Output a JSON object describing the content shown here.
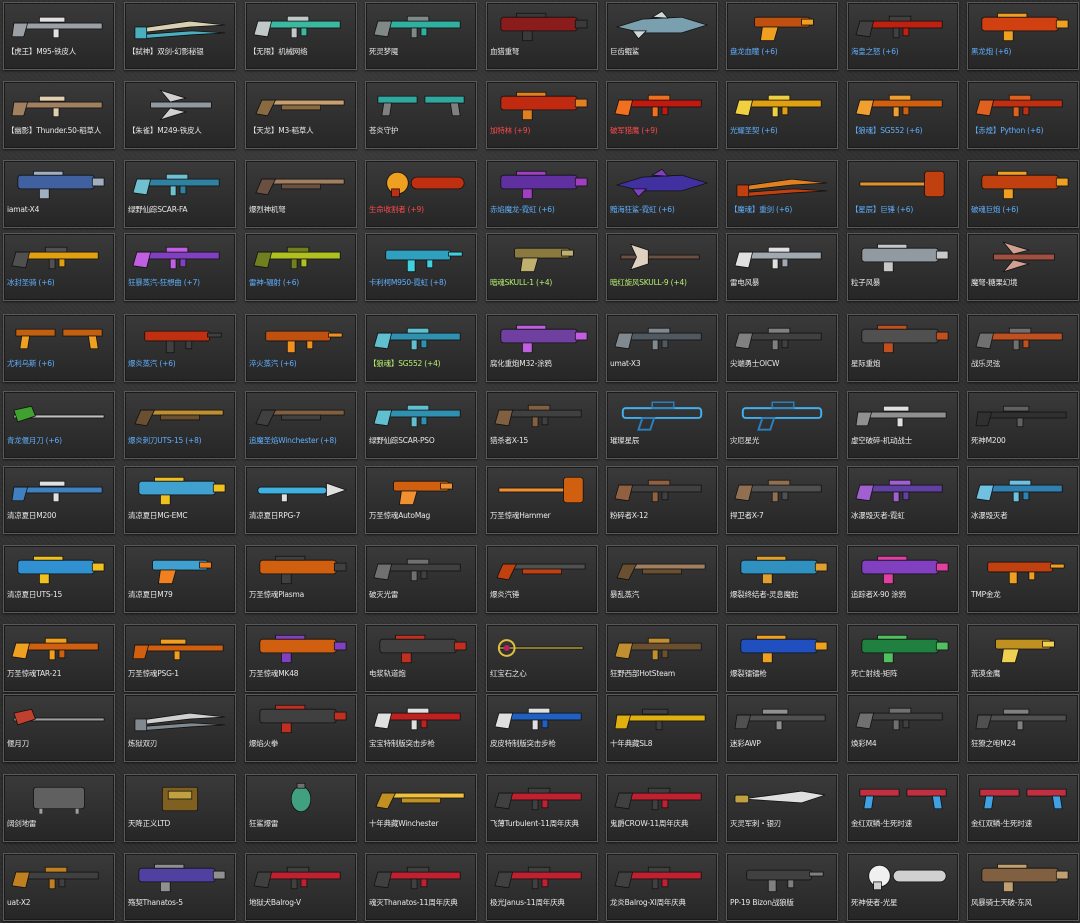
{
  "rows": [
    [
      {
        "name": "【虎王】M95-铁皮人",
        "color": "#e8e8e8",
        "weapon": "sniper",
        "palette": [
          "#9aa0a6",
          "#e0e0e0"
        ]
      },
      {
        "name": "【弑神】双剑-幻影秘银",
        "color": "#e8e8e8",
        "weapon": "blade",
        "palette": [
          "#4ab0c0",
          "#d8d0b0"
        ]
      },
      {
        "name": "【无限】机械网络",
        "color": "#e8e8e8",
        "weapon": "rifle",
        "palette": [
          "#3bb8a0",
          "#c0c8c8"
        ]
      },
      {
        "name": "死灵梦魇",
        "color": "#e8e8e8",
        "weapon": "rifle",
        "palette": [
          "#30b0a0",
          "#808888"
        ]
      },
      {
        "name": "血猎重弩",
        "color": "#e8e8e8",
        "weapon": "heavy",
        "palette": [
          "#8a1c1c",
          "#3a3a3a"
        ]
      },
      {
        "name": "巨齿鲲鲨",
        "color": "#e8e8e8",
        "weapon": "shark",
        "palette": [
          "#7aa0b0",
          "#d0d8dc"
        ]
      },
      {
        "name": "盘龙血瞳 (+6)",
        "color": "#5fb0ff",
        "weapon": "pistol",
        "palette": [
          "#c05010",
          "#f0a020"
        ]
      },
      {
        "name": "海皇之怒 (+6)",
        "color": "#5fb0ff",
        "weapon": "rifle",
        "palette": [
          "#c02010",
          "#404040"
        ]
      },
      {
        "name": "黑龙炮 (+6)",
        "color": "#5fb0ff",
        "weapon": "heavy",
        "palette": [
          "#d04010",
          "#f0a020"
        ]
      }
    ],
    [
      {
        "name": "【幽影】Thunder.50-稻草人",
        "color": "#e8e8e8",
        "weapon": "sniper",
        "palette": [
          "#a08060",
          "#e0d0b0"
        ]
      },
      {
        "name": "【朱雀】M249-铁皮人",
        "color": "#e8e8e8",
        "weapon": "wing",
        "palette": [
          "#9098a0",
          "#d0d0d0"
        ]
      },
      {
        "name": "【天龙】M3-稻草人",
        "color": "#e8e8e8",
        "weapon": "shotgun",
        "palette": [
          "#8a6a40",
          "#c8a070"
        ]
      },
      {
        "name": "苍炎守护",
        "color": "#e8e8e8",
        "weapon": "dual",
        "palette": [
          "#30a8a0",
          "#808080"
        ]
      },
      {
        "name": "加特林 (+9)",
        "color": "#ff4a4a",
        "weapon": "heavy",
        "palette": [
          "#c02a10",
          "#e08020"
        ]
      },
      {
        "name": "破军猎鹰 (+9)",
        "color": "#ff4a4a",
        "weapon": "rifle",
        "palette": [
          "#c01a10",
          "#f07020"
        ]
      },
      {
        "name": "光耀圣契 (+6)",
        "color": "#5fb0ff",
        "weapon": "rifle",
        "palette": [
          "#e0a010",
          "#f0d040"
        ]
      },
      {
        "name": "【狼魂】SG552 (+6)",
        "color": "#5fb0ff",
        "weapon": "rifle",
        "palette": [
          "#d06010",
          "#f0a030"
        ]
      },
      {
        "name": "【赤煌】Python (+6)",
        "color": "#5fb0ff",
        "weapon": "rifle",
        "palette": [
          "#c03010",
          "#e06020"
        ]
      }
    ],
    [
      {
        "name": "iamat-X4",
        "color": "#e8e8e8",
        "weapon": "heavy",
        "palette": [
          "#4060a0",
          "#a0b0c0"
        ]
      },
      {
        "name": "绿野仙踪SCAR-FA",
        "color": "#e8e8e8",
        "weapon": "rifle",
        "palette": [
          "#3080a0",
          "#70c0d0"
        ]
      },
      {
        "name": "爆烈神机弩",
        "color": "#e8e8e8",
        "weapon": "shotgun",
        "palette": [
          "#6a5040",
          "#a08060"
        ]
      },
      {
        "name": "生命收割者 (+9)",
        "color": "#ff4a4a",
        "weapon": "saw",
        "palette": [
          "#c03010",
          "#f0a020"
        ]
      },
      {
        "name": "赤焰魔龙-霓虹 (+6)",
        "color": "#5fb0ff",
        "weapon": "heavy",
        "palette": [
          "#6030a0",
          "#a040c0"
        ]
      },
      {
        "name": "黯海狂鲨-霓虹 (+6)",
        "color": "#5fb0ff",
        "weapon": "shark",
        "palette": [
          "#4030a0",
          "#8040c0"
        ]
      },
      {
        "name": "【魔魂】重剑 (+6)",
        "color": "#5fb0ff",
        "weapon": "blade",
        "palette": [
          "#c04010",
          "#e08020"
        ]
      },
      {
        "name": "【星辰】巨锤 (+6)",
        "color": "#5fb0ff",
        "weapon": "hammer",
        "palette": [
          "#c04010",
          "#e09030"
        ]
      },
      {
        "name": "破魂巨炮 (+6)",
        "color": "#5fb0ff",
        "weapon": "heavy",
        "palette": [
          "#c04010",
          "#f0a020"
        ]
      }
    ],
    [
      {
        "name": "冰封圣骑 (+6)",
        "color": "#5fb0ff",
        "weapon": "rifle",
        "palette": [
          "#e0a010",
          "#505050"
        ]
      },
      {
        "name": "狂暴蒸汽-狂想曲 (+7)",
        "color": "#5fb0ff",
        "weapon": "rifle",
        "palette": [
          "#8040c0",
          "#c060e0"
        ]
      },
      {
        "name": "雷神-辐射 (+6)",
        "color": "#5fb0ff",
        "weapon": "rifle",
        "palette": [
          "#b0c020",
          "#708020"
        ]
      },
      {
        "name": "卡利柯M950-霓虹 (+8)",
        "color": "#5fb0ff",
        "weapon": "smg",
        "palette": [
          "#30a0c0",
          "#40d0e0"
        ]
      },
      {
        "name": "暗魂SKULL-1 (+4)",
        "color": "#b8f070",
        "weapon": "pistol",
        "palette": [
          "#8a7a40",
          "#c0b070"
        ]
      },
      {
        "name": "暗红旋风SKULL-9 (+4)",
        "color": "#b8f070",
        "weapon": "axe",
        "palette": [
          "#6a5040",
          "#e0d0c0"
        ]
      },
      {
        "name": "雷电风暴",
        "color": "#e8e8e8",
        "weapon": "rifle",
        "palette": [
          "#a0a8b0",
          "#e0e0e0"
        ]
      },
      {
        "name": "粒子风暴",
        "color": "#e8e8e8",
        "weapon": "heavy",
        "palette": [
          "#909aa0",
          "#c8c8c8"
        ]
      },
      {
        "name": "魔弩-糖果幻境",
        "color": "#e8e8e8",
        "weapon": "wing",
        "palette": [
          "#a05040",
          "#d0a090"
        ]
      }
    ],
    [
      {
        "name": "尤利乌斯 (+6)",
        "color": "#5fb0ff",
        "weapon": "dual",
        "palette": [
          "#c06010",
          "#f0a020"
        ]
      },
      {
        "name": "爆炎蒸汽 (+6)",
        "color": "#5fb0ff",
        "weapon": "smg",
        "palette": [
          "#c03010",
          "#404040"
        ]
      },
      {
        "name": "淬火蒸汽 (+6)",
        "color": "#5fb0ff",
        "weapon": "smg",
        "palette": [
          "#c05010",
          "#f09020"
        ]
      },
      {
        "name": "【狼魂】SG552 (+4)",
        "color": "#b8f070",
        "weapon": "rifle",
        "palette": [
          "#3090b0",
          "#60c0d0"
        ]
      },
      {
        "name": "腐化重炮M32-涂鸦",
        "color": "#e8e8e8",
        "weapon": "heavy",
        "palette": [
          "#7040a0",
          "#c060e0"
        ]
      },
      {
        "name": "umat-X3",
        "color": "#e8e8e8",
        "weapon": "rifle",
        "palette": [
          "#505860",
          "#808890"
        ]
      },
      {
        "name": "尖端勇士OICW",
        "color": "#e8e8e8",
        "weapon": "rifle",
        "palette": [
          "#404040",
          "#808080"
        ]
      },
      {
        "name": "星际重炮",
        "color": "#e8e8e8",
        "weapon": "heavy",
        "palette": [
          "#505050",
          "#c05020"
        ]
      },
      {
        "name": "战乐灵弦",
        "color": "#e8e8e8",
        "weapon": "rifle",
        "palette": [
          "#c05020",
          "#707070"
        ]
      }
    ],
    [
      {
        "name": "青龙偃月刀 (+6)",
        "color": "#5fb0ff",
        "weapon": "spear",
        "palette": [
          "#40a030",
          "#c0c0c0"
        ]
      },
      {
        "name": "爆炎刺刀UTS-15 (+8)",
        "color": "#5fb0ff",
        "weapon": "shotgun",
        "palette": [
          "#6a5030",
          "#c09030"
        ]
      },
      {
        "name": "追魔圣焰Winchester (+8)",
        "color": "#5fb0ff",
        "weapon": "shotgun",
        "palette": [
          "#404040",
          "#806040"
        ]
      },
      {
        "name": "绿野仙踪SCAR-PSO",
        "color": "#e8e8e8",
        "weapon": "rifle",
        "palette": [
          "#3090b0",
          "#60c0d0"
        ]
      },
      {
        "name": "猎杀者X-15",
        "color": "#e8e8e8",
        "weapon": "rifle",
        "palette": [
          "#404040",
          "#806040"
        ]
      },
      {
        "name": "璀璨星辰",
        "color": "#e8e8e8",
        "weapon": "outline",
        "palette": [
          "#2a80c0",
          "#40b0f0"
        ]
      },
      {
        "name": "灾厄星光",
        "color": "#e8e8e8",
        "weapon": "outline",
        "palette": [
          "#2a80c0",
          "#40b0f0"
        ]
      },
      {
        "name": "虚空破碎-机动战士",
        "color": "#e8e8e8",
        "weapon": "sniper",
        "palette": [
          "#909090",
          "#e0e0e0"
        ]
      },
      {
        "name": "死神M200",
        "color": "#e8e8e8",
        "weapon": "sniper",
        "palette": [
          "#303030",
          "#606060"
        ]
      }
    ],
    [
      {
        "name": "清凉夏日M200",
        "color": "#e8e8e8",
        "weapon": "sniper",
        "palette": [
          "#4080c0",
          "#e0e0e0"
        ]
      },
      {
        "name": "清凉夏日MG-EMC",
        "color": "#e8e8e8",
        "weapon": "heavy",
        "palette": [
          "#40a0d0",
          "#f0c020"
        ]
      },
      {
        "name": "清凉夏日RPG-7",
        "color": "#e8e8e8",
        "weapon": "rpg",
        "palette": [
          "#40b0e0",
          "#e0e0e0"
        ]
      },
      {
        "name": "万圣惊魂AutoMag",
        "color": "#e8e8e8",
        "weapon": "pistol",
        "palette": [
          "#d06010",
          "#f09030"
        ]
      },
      {
        "name": "万圣惊魂Hammer",
        "color": "#e8e8e8",
        "weapon": "hammer",
        "palette": [
          "#d06010",
          "#f09030"
        ]
      },
      {
        "name": "粉碎者X-12",
        "color": "#e8e8e8",
        "weapon": "rifle",
        "palette": [
          "#404040",
          "#906040"
        ]
      },
      {
        "name": "捍卫者X-7",
        "color": "#e8e8e8",
        "weapon": "rifle",
        "palette": [
          "#505050",
          "#907050"
        ]
      },
      {
        "name": "冰瀑毁灭者-霓虹",
        "color": "#e8e8e8",
        "weapon": "rifle",
        "palette": [
          "#6040a0",
          "#a060d0"
        ]
      },
      {
        "name": "冰瀑毁灭者",
        "color": "#e8e8e8",
        "weapon": "rifle",
        "palette": [
          "#3080b0",
          "#70c0e0"
        ]
      }
    ],
    [
      {
        "name": "清凉夏日UTS-15",
        "color": "#e8e8e8",
        "weapon": "heavy",
        "palette": [
          "#3090d0",
          "#f0c020"
        ]
      },
      {
        "name": "清凉夏日M79",
        "color": "#e8e8e8",
        "weapon": "pistol",
        "palette": [
          "#40a0d0",
          "#f08020"
        ]
      },
      {
        "name": "万圣惊魂Plasma",
        "color": "#e8e8e8",
        "weapon": "heavy",
        "palette": [
          "#d06010",
          "#404040"
        ]
      },
      {
        "name": "破灭光雷",
        "color": "#e8e8e8",
        "weapon": "rifle",
        "palette": [
          "#404040",
          "#707070"
        ]
      },
      {
        "name": "爆炎汽锤",
        "color": "#e8e8e8",
        "weapon": "shotgun",
        "palette": [
          "#c04010",
          "#505050"
        ]
      },
      {
        "name": "暴乱蒸汽",
        "color": "#e8e8e8",
        "weapon": "shotgun",
        "palette": [
          "#6a5030",
          "#a08060"
        ]
      },
      {
        "name": "爆裂终结者-灵息魔蛇",
        "color": "#e8e8e8",
        "weapon": "heavy",
        "palette": [
          "#3090c0",
          "#e0a030"
        ]
      },
      {
        "name": "追踪者X-90 涂鸦",
        "color": "#e8e8e8",
        "weapon": "heavy",
        "palette": [
          "#8040c0",
          "#e040a0"
        ]
      },
      {
        "name": "TMP金龙",
        "color": "#e8e8e8",
        "weapon": "smg",
        "palette": [
          "#c04010",
          "#f0a020"
        ]
      }
    ],
    [
      {
        "name": "万圣惊魂TAR-21",
        "color": "#e8e8e8",
        "weapon": "rifle",
        "palette": [
          "#d06010",
          "#f0a020"
        ]
      },
      {
        "name": "万圣惊魂PSG-1",
        "color": "#e8e8e8",
        "weapon": "sniper",
        "palette": [
          "#d06010",
          "#f0a020"
        ]
      },
      {
        "name": "万圣惊魂MK48",
        "color": "#e8e8e8",
        "weapon": "heavy",
        "palette": [
          "#d06010",
          "#8040c0"
        ]
      },
      {
        "name": "电浆轨道炮",
        "color": "#e8e8e8",
        "weapon": "heavy",
        "palette": [
          "#404040",
          "#c03020"
        ]
      },
      {
        "name": "红宝石之心",
        "color": "#e8e8e8",
        "weapon": "staff",
        "palette": [
          "#e0c040",
          "#c02060"
        ]
      },
      {
        "name": "狂野西部HotSteam",
        "color": "#e8e8e8",
        "weapon": "rifle",
        "palette": [
          "#6a5030",
          "#c09030"
        ]
      },
      {
        "name": "爆裂镭镭枪",
        "color": "#e8e8e8",
        "weapon": "heavy",
        "palette": [
          "#2050c0",
          "#f0a020"
        ]
      },
      {
        "name": "死亡射线-矩阵",
        "color": "#e8e8e8",
        "weapon": "heavy",
        "palette": [
          "#208040",
          "#50c060"
        ]
      },
      {
        "name": "荒漠金鹰",
        "color": "#e8e8e8",
        "weapon": "pistol",
        "palette": [
          "#c09020",
          "#f0d050"
        ]
      }
    ],
    [
      {
        "name": "偃月刀",
        "color": "#e8e8e8",
        "weapon": "spear",
        "palette": [
          "#c04030",
          "#a0a0a0"
        ]
      },
      {
        "name": "炼狱双刃",
        "color": "#e8e8e8",
        "weapon": "blade",
        "palette": [
          "#808890",
          "#d0d0d0"
        ]
      },
      {
        "name": "爆焰火拳",
        "color": "#e8e8e8",
        "weapon": "heavy",
        "palette": [
          "#404040",
          "#c03020"
        ]
      },
      {
        "name": "宝宝特制版突击步枪",
        "color": "#e8e8e8",
        "weapon": "rifle",
        "palette": [
          "#c02020",
          "#e0e0e0"
        ]
      },
      {
        "name": "皮皮特制版突击步枪",
        "color": "#e8e8e8",
        "weapon": "rifle",
        "palette": [
          "#2060c0",
          "#e0e0e0"
        ]
      },
      {
        "name": "十年典藏SL8",
        "color": "#e8e8e8",
        "weapon": "sniper",
        "palette": [
          "#e0b010",
          "#404040"
        ]
      },
      {
        "name": "迷彩AWP",
        "color": "#e8e8e8",
        "weapon": "sniper",
        "palette": [
          "#505050",
          "#909090"
        ]
      },
      {
        "name": "焕彩M4",
        "color": "#e8e8e8",
        "weapon": "rifle",
        "palette": [
          "#404040",
          "#707070"
        ]
      },
      {
        "name": "狂獠之咆M24",
        "color": "#e8e8e8",
        "weapon": "sniper",
        "palette": [
          "#505050",
          "#808080"
        ]
      }
    ],
    [
      {
        "name": "阔剑地雷",
        "color": "#e8e8e8",
        "weapon": "mine",
        "palette": [
          "#606060",
          "#a0a0a0"
        ]
      },
      {
        "name": "天降正义LTD",
        "color": "#e8e8e8",
        "weapon": "box",
        "palette": [
          "#806020",
          "#c0a040"
        ]
      },
      {
        "name": "狂鲨爆雷",
        "color": "#e8e8e8",
        "weapon": "grenade",
        "palette": [
          "#40a080",
          "#707070"
        ]
      },
      {
        "name": "十年典藏Winchester",
        "color": "#e8e8e8",
        "weapon": "shotgun",
        "palette": [
          "#c09020",
          "#f0c040"
        ]
      },
      {
        "name": "飞薄Turbulent-11周年庆典",
        "color": "#e8e8e8",
        "weapon": "rifle",
        "palette": [
          "#c02030",
          "#404040"
        ]
      },
      {
        "name": "鬼爵CROW-11周年庆典",
        "color": "#e8e8e8",
        "weapon": "rifle",
        "palette": [
          "#c02030",
          "#404040"
        ]
      },
      {
        "name": "灭灵军刺・银刃",
        "color": "#e8e8e8",
        "weapon": "knife",
        "palette": [
          "#c0a040",
          "#e0e0e0"
        ]
      },
      {
        "name": "金红双鳞-生死时速",
        "color": "#e8e8e8",
        "weapon": "dual",
        "palette": [
          "#c03040",
          "#40a0e0"
        ]
      },
      {
        "name": "金红双鳞-生死时速",
        "color": "#e8e8e8",
        "weapon": "dual",
        "palette": [
          "#c03040",
          "#40a0e0"
        ]
      }
    ],
    [
      {
        "name": "uat-X2",
        "color": "#e8e8e8",
        "weapon": "rifle",
        "palette": [
          "#404040",
          "#c08020"
        ]
      },
      {
        "name": "殇契Thanatos-5",
        "color": "#e8e8e8",
        "weapon": "heavy",
        "palette": [
          "#5040a0",
          "#909090"
        ]
      },
      {
        "name": "地狱犬Balrog-V",
        "color": "#e8e8e8",
        "weapon": "rifle",
        "palette": [
          "#c02030",
          "#404040"
        ]
      },
      {
        "name": "魂灭Thanatos-11周年庆典",
        "color": "#e8e8e8",
        "weapon": "rifle",
        "palette": [
          "#c02030",
          "#404040"
        ]
      },
      {
        "name": "极光Janus-11周年庆典",
        "color": "#e8e8e8",
        "weapon": "rifle",
        "palette": [
          "#c02030",
          "#404040"
        ]
      },
      {
        "name": "龙炎Balrog-XI周年庆典",
        "color": "#e8e8e8",
        "weapon": "rifle",
        "palette": [
          "#c02030",
          "#404040"
        ]
      },
      {
        "name": "PP-19 Bizon战狼版",
        "color": "#e8e8e8",
        "weapon": "smg",
        "palette": [
          "#404040",
          "#808080"
        ]
      },
      {
        "name": "死神使者-光星",
        "color": "#e8e8e8",
        "weapon": "saw",
        "palette": [
          "#d0d0d0",
          "#f0f0f0"
        ]
      },
      {
        "name": "风暴骑士天破-东风",
        "color": "#e8e8e8",
        "weapon": "heavy",
        "palette": [
          "#806040",
          "#c0a070"
        ]
      }
    ]
  ]
}
